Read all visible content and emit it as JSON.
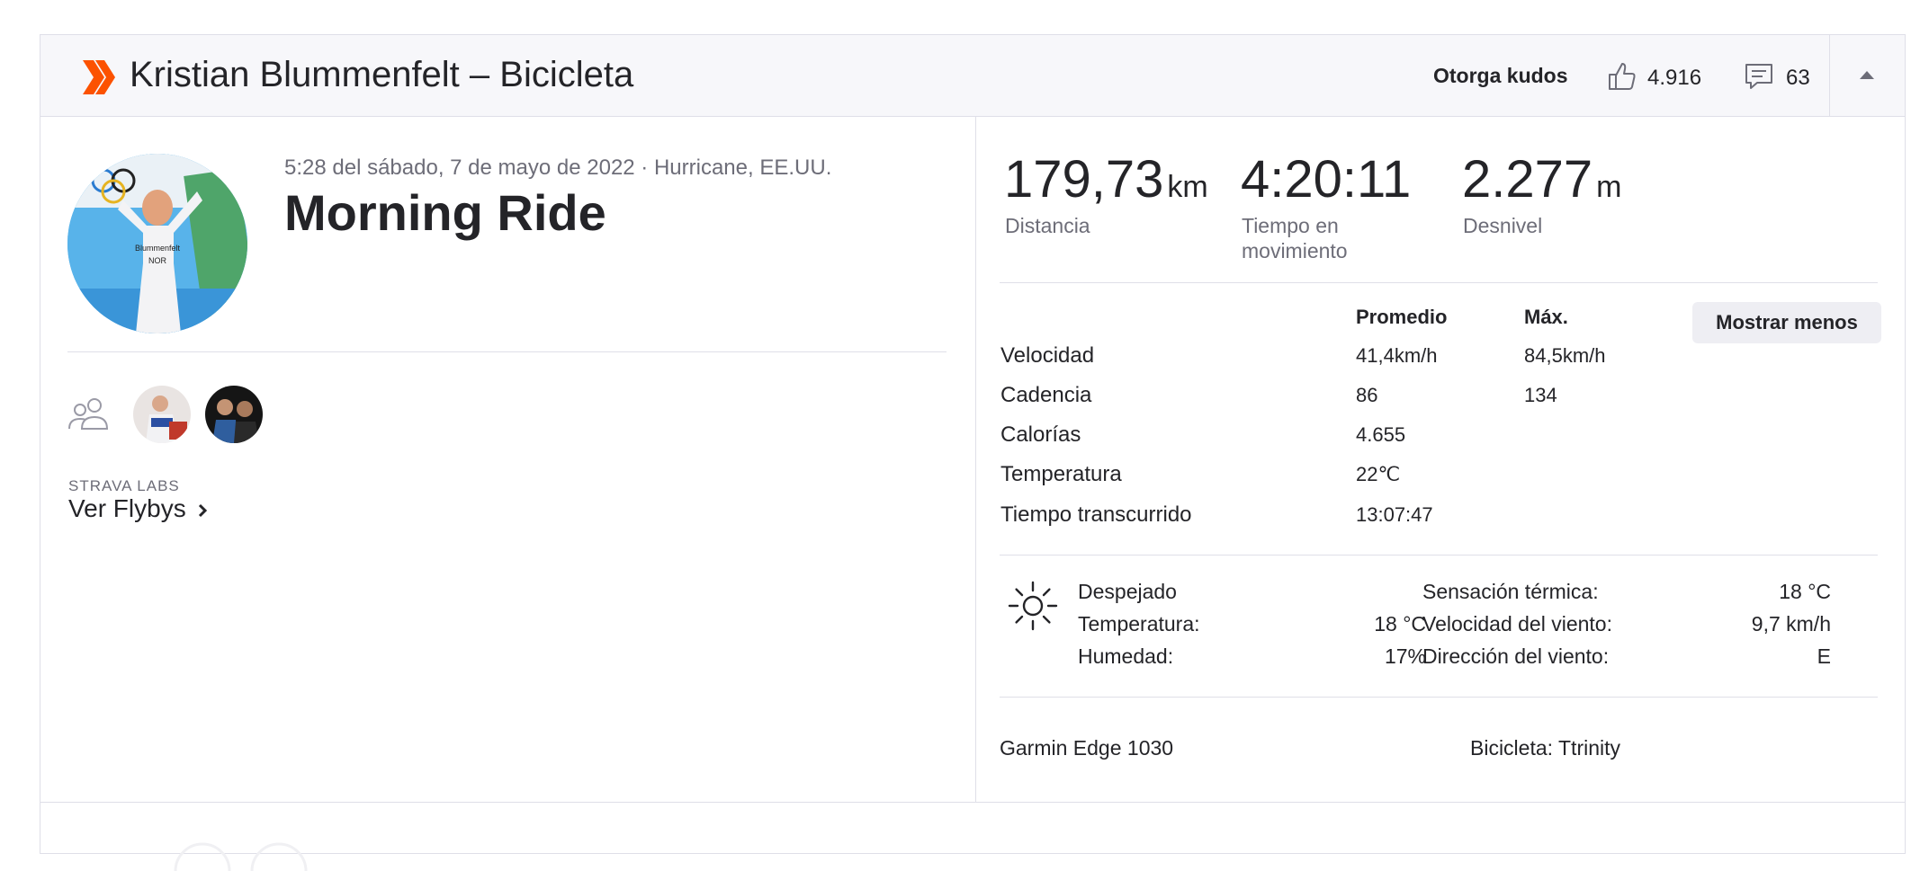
{
  "header": {
    "title": "Kristian Blummenfelt – Bicicleta",
    "kudos_label": "Otorga kudos",
    "kudos_count": "4.916",
    "comments_count": "63",
    "sport_icon": "strava-chevron-icon",
    "collapse_icon": "caret-up-icon"
  },
  "activity": {
    "meta": "5:28 del sábado, 7 de mayo de 2022 · Hurricane, EE.UU.",
    "name": "Morning Ride",
    "labs_label": "STRAVA LABS",
    "flybys_label": "Ver Flybys"
  },
  "primary_stats": [
    {
      "value": "179,73",
      "unit": "km",
      "label": "Distancia"
    },
    {
      "value": "4:20:11",
      "unit": "",
      "label_line1": "Tiempo en",
      "label_line2": "movimiento"
    },
    {
      "value": "2.277",
      "unit": "m",
      "label": "Desnivel"
    }
  ],
  "details": {
    "col_avg": "Promedio",
    "col_max": "Máx.",
    "toggle_label": "Mostrar menos",
    "rows": [
      {
        "label": "Velocidad",
        "avg": "41,4km/h",
        "max": "84,5km/h"
      },
      {
        "label": "Cadencia",
        "avg": "86",
        "max": "134"
      },
      {
        "label": "Calorías",
        "avg": "4.655",
        "max": ""
      },
      {
        "label": "Temperatura",
        "avg": "22℃",
        "max": ""
      },
      {
        "label": "Tiempo transcurrido",
        "avg": "13:07:47",
        "max": ""
      }
    ]
  },
  "weather": {
    "icon": "sun-icon",
    "condition": "Despejado",
    "temp_label": "Temperatura:",
    "temp_value": "18 °C",
    "humidity_label": "Humedad:",
    "humidity_value": "17%",
    "feels_label": "Sensación térmica:",
    "feels_value": "18 °C",
    "wind_speed_label": "Velocidad del viento:",
    "wind_speed_value": "9,7 km/h",
    "wind_dir_label": "Dirección del viento:",
    "wind_dir_value": "E"
  },
  "gear": {
    "device": "Garmin Edge 1030",
    "bike": "Bicicleta: Ttrinity"
  },
  "colors": {
    "strava_orange": "#fc5200",
    "border": "#dfdfe8",
    "muted_text": "#6d6d78"
  }
}
